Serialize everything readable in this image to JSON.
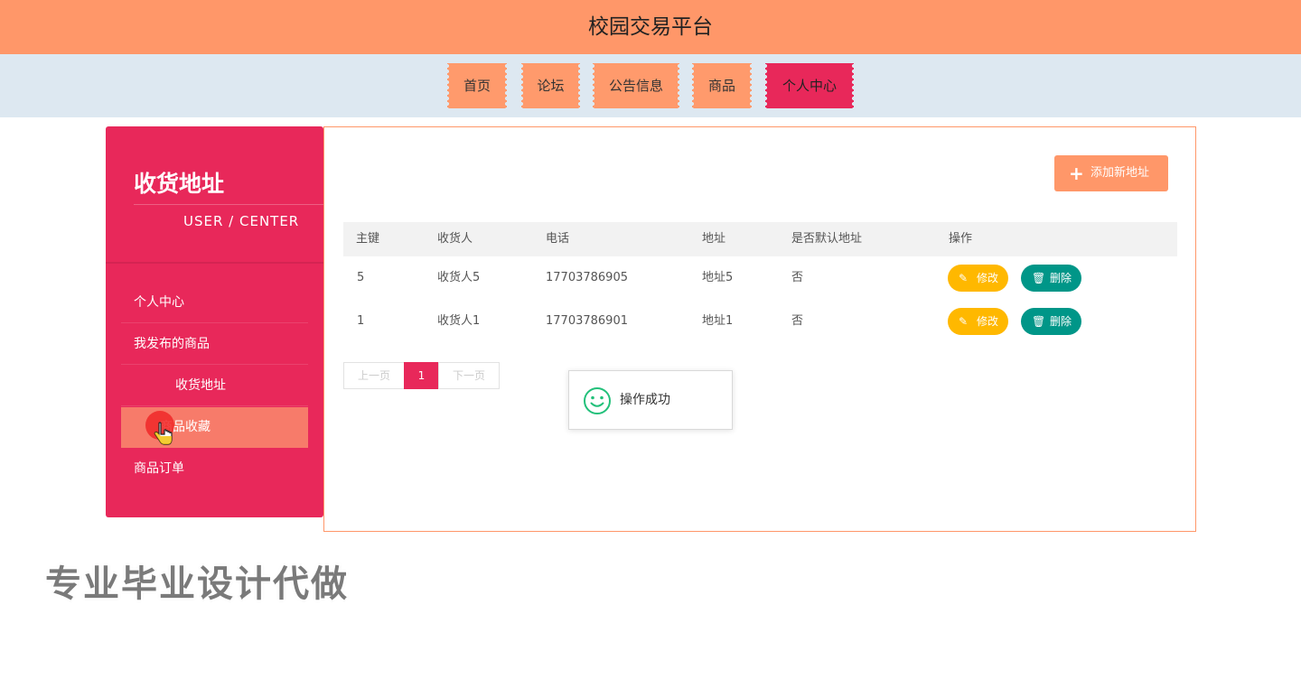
{
  "header": {
    "title": "校园交易平台"
  },
  "nav": {
    "items": [
      {
        "label": "首页"
      },
      {
        "label": "论坛"
      },
      {
        "label": "公告信息"
      },
      {
        "label": "商品"
      },
      {
        "label": "个人中心",
        "active": true
      }
    ]
  },
  "sidebar": {
    "title": "收货地址",
    "subtitle": "USER / CENTER",
    "items": [
      {
        "label": "个人中心"
      },
      {
        "label": "我发布的商品"
      },
      {
        "label": "收货地址"
      },
      {
        "label": "商品收藏"
      },
      {
        "label": "商品订单"
      }
    ]
  },
  "main": {
    "add_button": "添加新地址",
    "table": {
      "headers": [
        "主键",
        "收货人",
        "电话",
        "地址",
        "是否默认地址",
        "操作"
      ],
      "rows": [
        {
          "id": "5",
          "receiver": "收货人5",
          "phone": "17703786905",
          "address": "地址5",
          "is_default": "否"
        },
        {
          "id": "1",
          "receiver": "收货人1",
          "phone": "17703786901",
          "address": "地址1",
          "is_default": "否"
        }
      ],
      "edit_label": "修改",
      "delete_label": "删除"
    },
    "pager": {
      "prev": "上一页",
      "current": "1",
      "next": "下一页"
    }
  },
  "toast": {
    "message": "操作成功"
  },
  "watermark": "专业毕业设计代做",
  "colors": {
    "header": "#ff9769",
    "nav_bg": "#dde8f1",
    "accent": "#e8285a",
    "edit": "#ffb800",
    "delete": "#009688"
  }
}
